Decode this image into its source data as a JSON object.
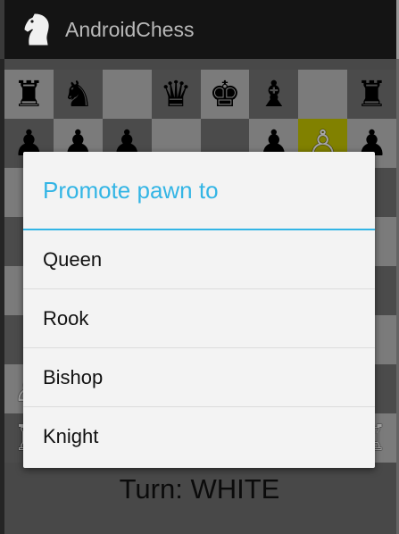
{
  "app": {
    "title": "AndroidChess",
    "icon": "knight-icon"
  },
  "board": {
    "highlighted": [
      1,
      6
    ],
    "rows": [
      [
        {
          "p": "♜",
          "c": "b"
        },
        {
          "p": "♞",
          "c": "b"
        },
        {
          "p": "",
          "c": ""
        },
        {
          "p": "♛",
          "c": "b"
        },
        {
          "p": "♚",
          "c": "b"
        },
        {
          "p": "♝",
          "c": "b"
        },
        {
          "p": "",
          "c": ""
        },
        {
          "p": "♜",
          "c": "b"
        }
      ],
      [
        {
          "p": "♟",
          "c": "b"
        },
        {
          "p": "♟",
          "c": "b"
        },
        {
          "p": "♟",
          "c": "b"
        },
        {
          "p": "",
          "c": ""
        },
        {
          "p": "",
          "c": ""
        },
        {
          "p": "♟",
          "c": "b"
        },
        {
          "p": "♙",
          "c": "w"
        },
        {
          "p": "♟",
          "c": "b"
        }
      ],
      [
        {
          "p": "",
          "c": ""
        },
        {
          "p": "",
          "c": ""
        },
        {
          "p": "",
          "c": ""
        },
        {
          "p": "",
          "c": ""
        },
        {
          "p": "",
          "c": ""
        },
        {
          "p": "",
          "c": ""
        },
        {
          "p": "",
          "c": ""
        },
        {
          "p": "",
          "c": ""
        }
      ],
      [
        {
          "p": "",
          "c": ""
        },
        {
          "p": "",
          "c": ""
        },
        {
          "p": "",
          "c": ""
        },
        {
          "p": "",
          "c": ""
        },
        {
          "p": "",
          "c": ""
        },
        {
          "p": "",
          "c": ""
        },
        {
          "p": "",
          "c": ""
        },
        {
          "p": "",
          "c": ""
        }
      ],
      [
        {
          "p": "",
          "c": ""
        },
        {
          "p": "",
          "c": ""
        },
        {
          "p": "",
          "c": ""
        },
        {
          "p": "",
          "c": ""
        },
        {
          "p": "",
          "c": ""
        },
        {
          "p": "",
          "c": ""
        },
        {
          "p": "",
          "c": ""
        },
        {
          "p": "",
          "c": ""
        }
      ],
      [
        {
          "p": "",
          "c": ""
        },
        {
          "p": "",
          "c": ""
        },
        {
          "p": "",
          "c": ""
        },
        {
          "p": "",
          "c": ""
        },
        {
          "p": "",
          "c": ""
        },
        {
          "p": "",
          "c": ""
        },
        {
          "p": "",
          "c": ""
        },
        {
          "p": "",
          "c": ""
        }
      ],
      [
        {
          "p": "♙",
          "c": "w"
        },
        {
          "p": "",
          "c": ""
        },
        {
          "p": "",
          "c": ""
        },
        {
          "p": "",
          "c": ""
        },
        {
          "p": "",
          "c": ""
        },
        {
          "p": "",
          "c": ""
        },
        {
          "p": "",
          "c": ""
        },
        {
          "p": "",
          "c": ""
        }
      ],
      [
        {
          "p": "♖",
          "c": "w"
        },
        {
          "p": "",
          "c": ""
        },
        {
          "p": "",
          "c": ""
        },
        {
          "p": "",
          "c": ""
        },
        {
          "p": "",
          "c": ""
        },
        {
          "p": "",
          "c": ""
        },
        {
          "p": "",
          "c": ""
        },
        {
          "p": "♖",
          "c": "w"
        }
      ]
    ]
  },
  "status": {
    "turn": "Turn: WHITE"
  },
  "dialog": {
    "title": "Promote pawn to",
    "options": [
      "Queen",
      "Rook",
      "Bishop",
      "Knight"
    ]
  },
  "colors": {
    "accent": "#33b5e5",
    "action_bar": "#141414",
    "highlight": "#c7c700"
  }
}
